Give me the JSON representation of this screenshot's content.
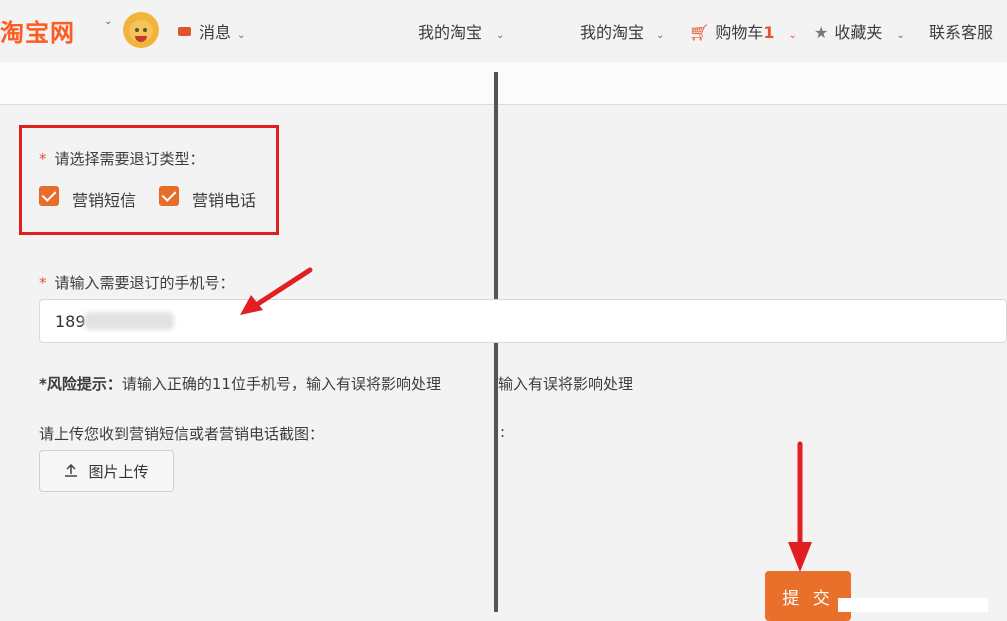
{
  "header": {
    "logo": "淘宝网",
    "messages": "消息",
    "my_taobao_center": "我的淘宝",
    "my_taobao": "我的淘宝",
    "cart_label": "购物车",
    "cart_count": "1",
    "favorites": "收藏夹",
    "customer_service": "联系客服"
  },
  "form": {
    "type_label": "请选择需要退订类型：",
    "options": [
      {
        "label": "营销短信",
        "checked": true
      },
      {
        "label": "营销电话",
        "checked": true
      }
    ],
    "phone_label": "请输入需要退订的手机号：",
    "phone_value": "189",
    "risk_label": "*风险提示：",
    "risk_text": "请输入正确的11位手机号，输入有误将影响处理",
    "risk_echo": "输入有误将影响处理",
    "upload_label": "请上传您收到营销短信或者营销电话截图：",
    "upload_echo": ":",
    "upload_button": "图片上传",
    "submit_button": "提 交"
  },
  "colors": {
    "accent": "#e8702b",
    "annotation": "#e02020"
  },
  "icons": [
    "avatar",
    "mail-icon",
    "cart-icon",
    "star-icon",
    "upload-icon",
    "checkbox-checked-icon"
  ]
}
